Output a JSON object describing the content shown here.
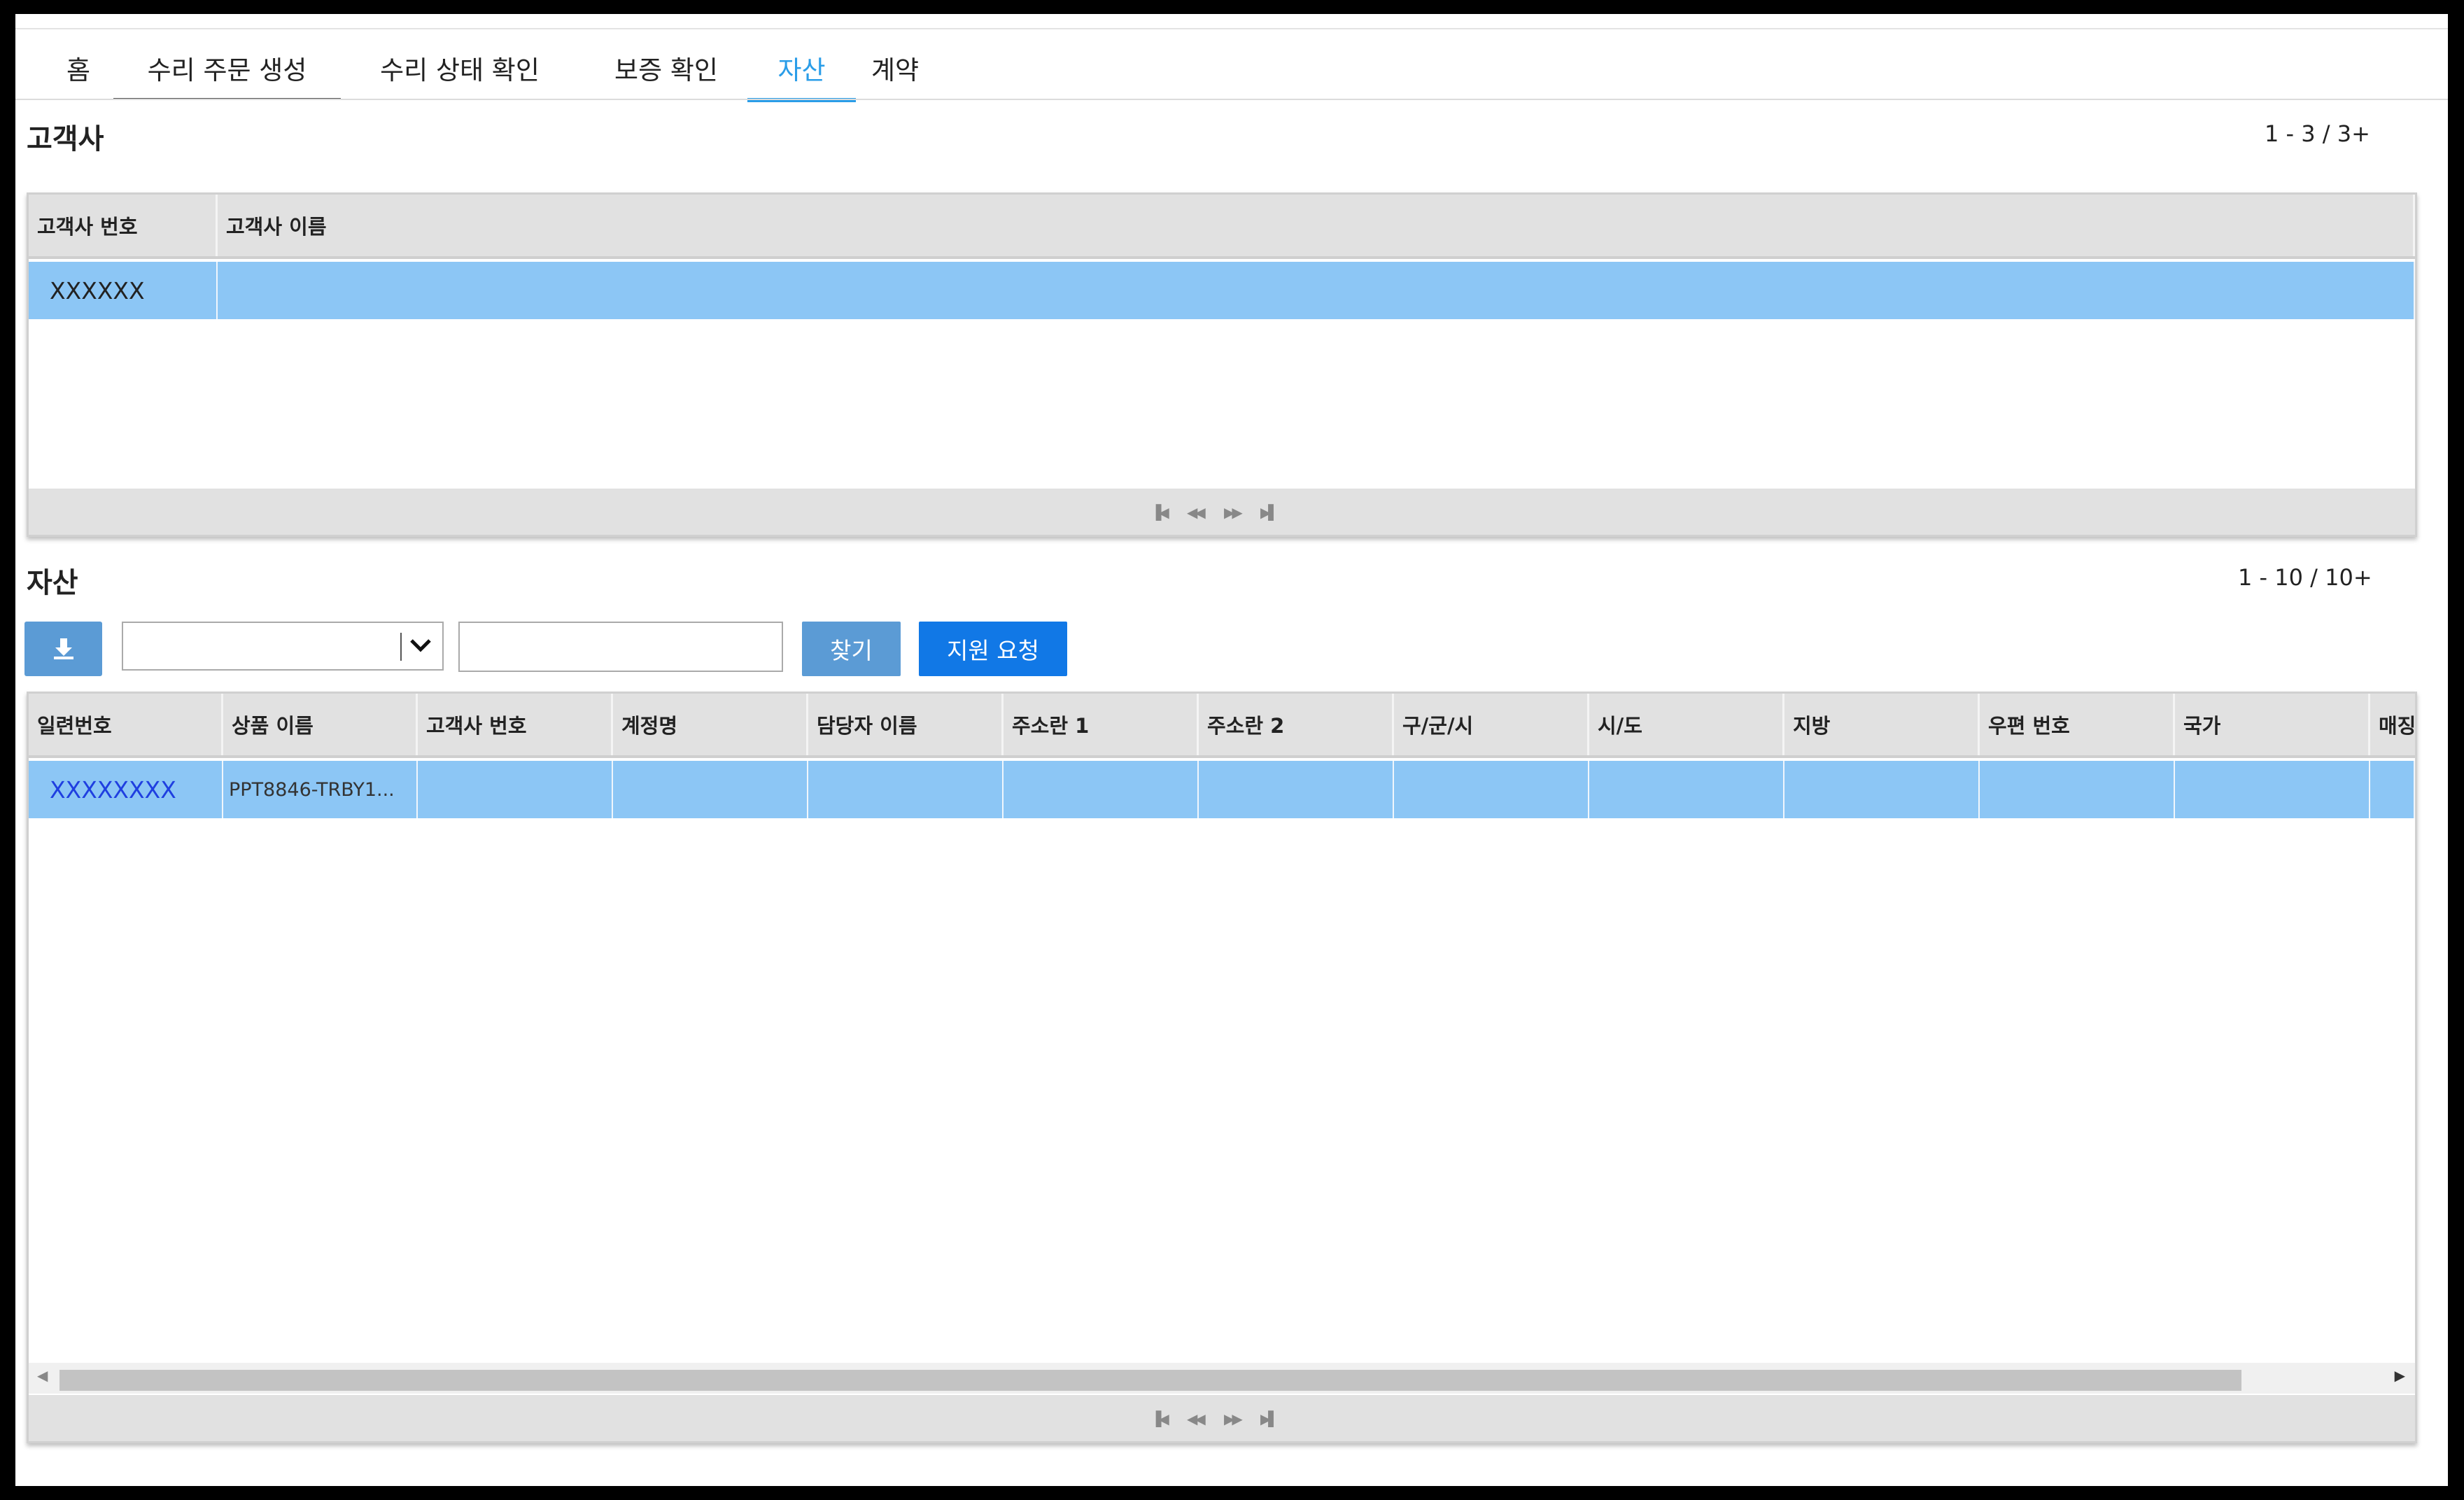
{
  "tabs": [
    {
      "label": "홈"
    },
    {
      "label": "수리 주문 생성"
    },
    {
      "label": "수리 상태 확인"
    },
    {
      "label": "보증 확인"
    },
    {
      "label": "자산"
    },
    {
      "label": "계약"
    }
  ],
  "customers": {
    "title": "고객사",
    "counter": "1 - 3 / 3+",
    "columns": [
      "고객사 번호",
      "고객사 이름"
    ],
    "rows": [
      {
        "number": "XXXXXX",
        "name": ""
      }
    ]
  },
  "assets": {
    "title": "자산",
    "counter": "1 - 10 / 10+",
    "search_value": "",
    "find_label": "찾기",
    "support_label": "지원 요청",
    "columns": [
      "일련번호",
      "상품 이름",
      "고객사 번호",
      "계정명",
      "담당자 이름",
      "주소란 1",
      "주소란 2",
      "구/군/시",
      "시/도",
      "지방",
      "우편 번호",
      "국가",
      "매징"
    ],
    "rows": [
      {
        "serial": "XXXXXXXX",
        "product": "PPT8846-TRBY1..."
      }
    ]
  },
  "colors": {
    "accent": "#2a9de8",
    "selected_row": "#8cc6f5",
    "button": "#5b9bd5",
    "primary_button": "#1178e6",
    "link": "#1f3fe0"
  },
  "icons": {
    "download": "download-icon",
    "dropdown": "chevron-down-icon",
    "pager": [
      "first-page-icon",
      "prev-page-icon",
      "next-page-icon",
      "last-page-icon"
    ],
    "scroll": [
      "scroll-left-icon",
      "scroll-right-icon"
    ]
  }
}
